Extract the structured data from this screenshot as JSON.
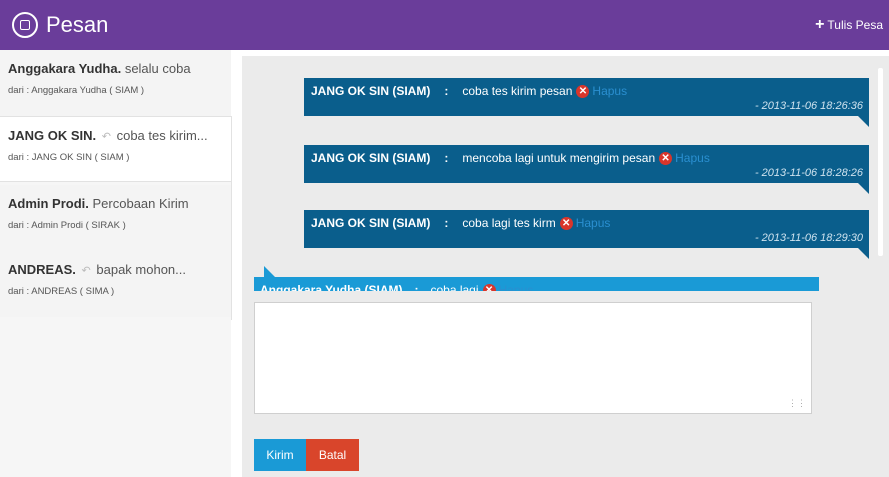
{
  "header": {
    "title": "Pesan",
    "compose_label": "Tulis Pesa",
    "compose_icon": "plus-icon",
    "logo_icon": "message-box-icon",
    "bg_color": "#6a3d9a"
  },
  "inbox": [
    {
      "sender": "Anggakara Yudha.",
      "preview": "selalu coba",
      "replied": false,
      "from": "dari : Anggakara Yudha ( SIAM )"
    },
    {
      "sender": "JANG OK SIN.",
      "preview": "coba tes kirim...",
      "replied": true,
      "from": "dari : JANG OK SIN ( SIAM )"
    },
    {
      "sender": "Admin Prodi.",
      "preview": "Percobaan Kirim",
      "replied": false,
      "from": "dari : Admin Prodi ( SIRAK )"
    },
    {
      "sender": "ANDREAS.",
      "preview": "bapak mohon...",
      "replied": true,
      "from": "dari : ANDREAS ( SIMA )"
    }
  ],
  "conversation": {
    "separator": ":",
    "delete_label": "Hapus",
    "outgoing": [
      {
        "name": "JANG OK SIN (SIAM)",
        "text": "coba tes kirim pesan",
        "time": "- 2013-11-06 18:26:36"
      },
      {
        "name": "JANG OK SIN (SIAM)",
        "text": "mencoba lagi untuk mengirim pesan",
        "time": "- 2013-11-06 18:28:26"
      },
      {
        "name": "JANG OK SIN (SIAM)",
        "text": "coba lagi tes kirm",
        "time": "- 2013-11-06 18:29:30"
      }
    ],
    "incoming": [
      {
        "name": "Anggakara Yudha (SIAM)",
        "text": "coba lagi"
      }
    ],
    "outgoing_color": "#0a5e8c",
    "incoming_color": "#1a9ad6"
  },
  "reply": {
    "value": "",
    "send_label": "Kirim",
    "cancel_label": "Batal"
  }
}
